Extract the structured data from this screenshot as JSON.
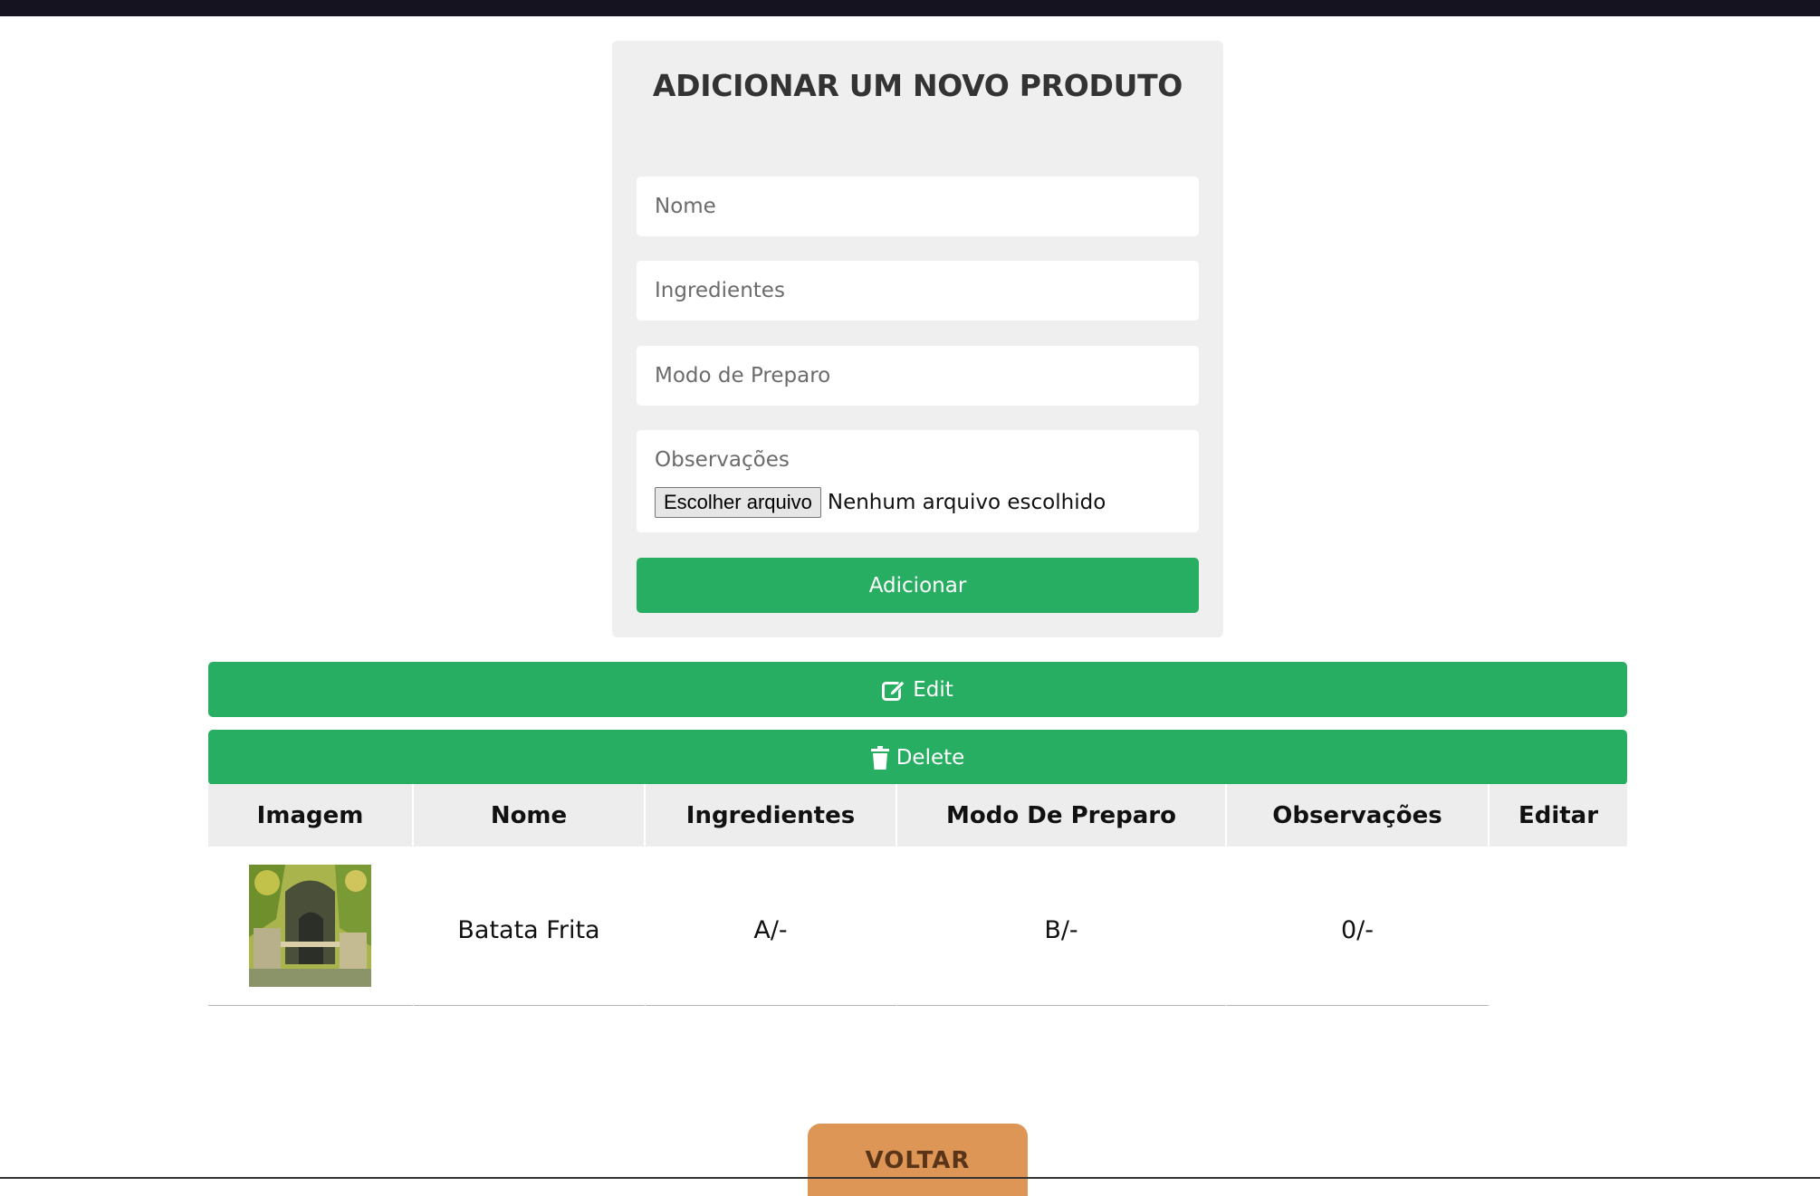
{
  "form": {
    "title": "ADICIONAR UM NOVO PRODUTO",
    "fields": {
      "nome_placeholder": "Nome",
      "ingredientes_placeholder": "Ingredientes",
      "modo_placeholder": "Modo de Preparo",
      "observacoes_placeholder": "Observações"
    },
    "file": {
      "button_label": "Escolher arquivo",
      "status": "Nenhum arquivo escolhido"
    },
    "submit_label": "Adicionar"
  },
  "actions": {
    "edit_label": "Edit",
    "delete_label": "Delete",
    "edit_icon": "edit-icon",
    "delete_icon": "trash-icon"
  },
  "table": {
    "headers": [
      "Imagem",
      "Nome",
      "Ingredientes",
      "Modo De Preparo",
      "Observações",
      "Editar"
    ],
    "rows": [
      {
        "nome": "Batata Frita",
        "ingredientes": "A/-",
        "modo": "B/-",
        "observacoes": "0/-",
        "editar": ""
      }
    ]
  },
  "back_label": "VOLTAR",
  "colors": {
    "accent_green": "#28ae62",
    "back_orange": "#de9656",
    "card_bg": "#efefef",
    "top_bar": "#14131f"
  }
}
